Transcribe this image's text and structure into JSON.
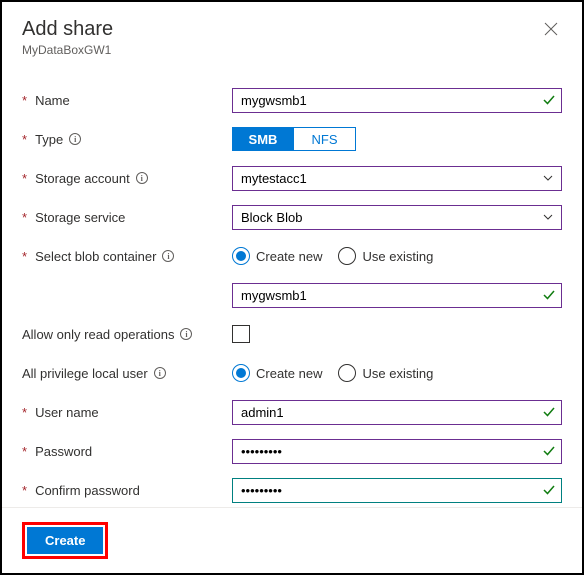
{
  "header": {
    "title": "Add share",
    "subtitle": "MyDataBoxGW1"
  },
  "labels": {
    "name": "Name",
    "type": "Type",
    "storage_account": "Storage account",
    "storage_service": "Storage service",
    "select_blob_container": "Select blob container",
    "allow_read_only": "Allow only read operations",
    "all_priv_user": "All privilege local user",
    "user_name": "User name",
    "password": "Password",
    "confirm_password": "Confirm password"
  },
  "values": {
    "name": "mygwsmb1",
    "storage_account": "mytestacc1",
    "storage_service": "Block Blob",
    "container": "mygwsmb1",
    "user_name": "admin1",
    "password": "•••••••••",
    "confirm_password": "•••••••••"
  },
  "type_toggle": {
    "smb": "SMB",
    "nfs": "NFS",
    "selected": "SMB"
  },
  "radio": {
    "create_new": "Create new",
    "use_existing": "Use existing"
  },
  "footer": {
    "create": "Create"
  }
}
